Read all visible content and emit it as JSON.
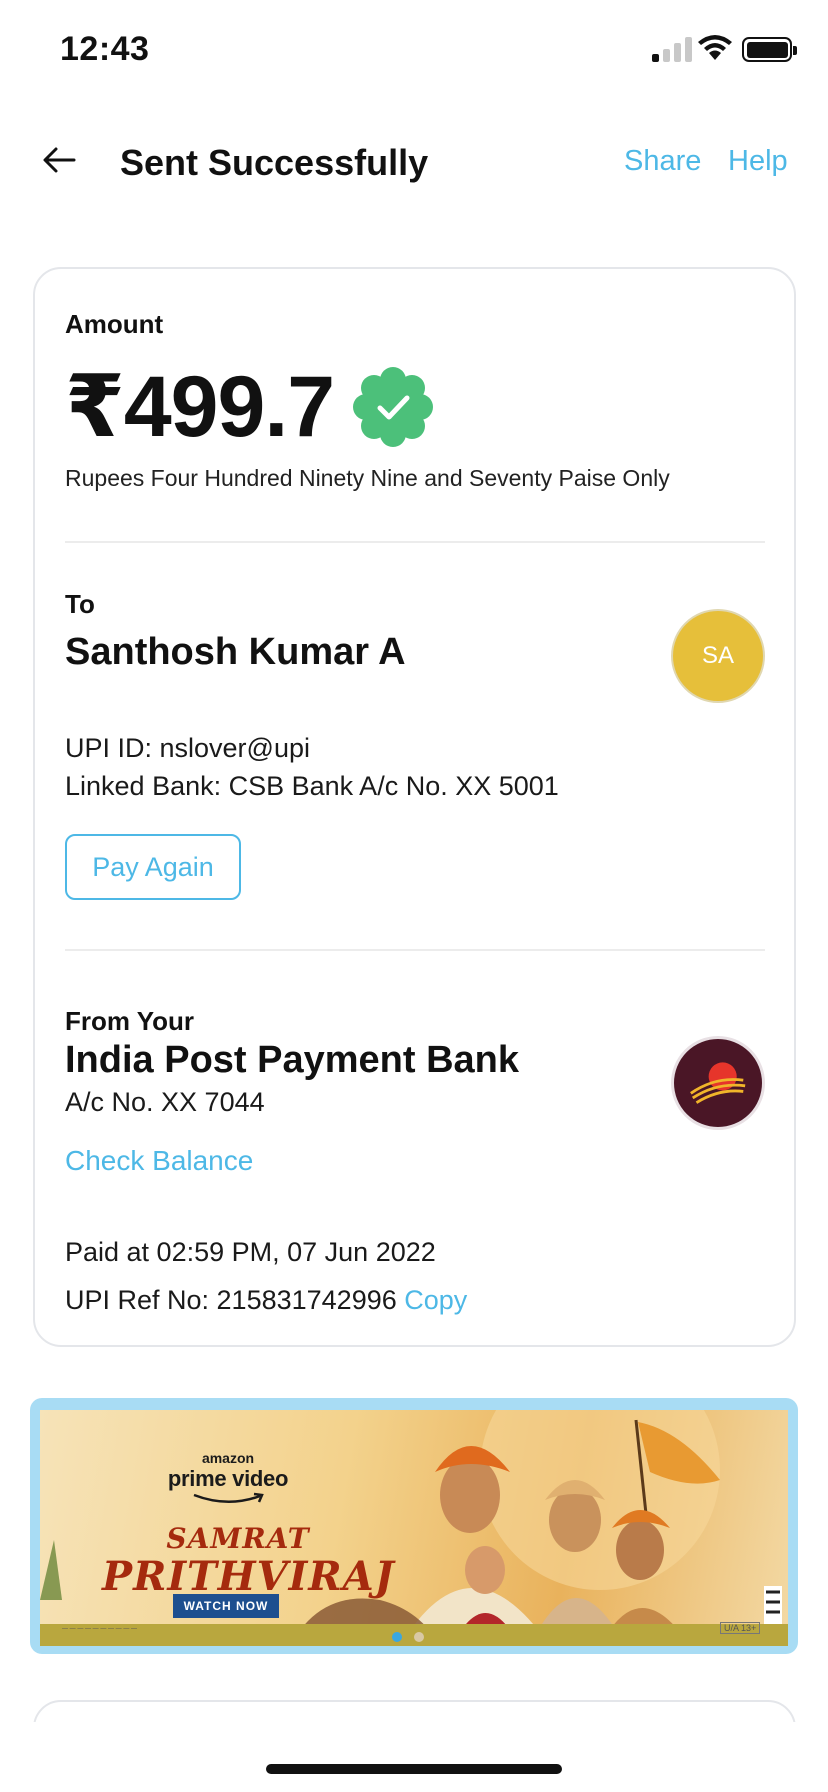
{
  "status_bar": {
    "time": "12:43"
  },
  "header": {
    "title": "Sent Successfully",
    "share_label": "Share",
    "help_label": "Help"
  },
  "amount": {
    "label": "Amount",
    "value": "₹499.7",
    "in_words": "Rupees Four Hundred Ninety Nine and Seventy Paise Only"
  },
  "recipient": {
    "label": "To",
    "name": "Santhosh Kumar A",
    "initials": "SA",
    "upi_id": "UPI ID: nslover@upi",
    "linked_bank": "Linked Bank: CSB Bank A/c No. XX 5001",
    "pay_again_label": "Pay Again"
  },
  "source": {
    "label": "From Your",
    "bank_name": "India Post Payment Bank",
    "account": "A/c No. XX 7044",
    "check_balance_label": "Check Balance"
  },
  "transaction": {
    "paid_at": "Paid at 02:59 PM, 07 Jun 2022",
    "ref_prefix": "UPI Ref No: 215831742996",
    "copy_label": "Copy"
  },
  "banner": {
    "brand_top": "amazon",
    "brand_main": "prime video",
    "title_line1": "SAMRAT",
    "title_line2": "PRITHVIRAJ",
    "cta": "WATCH NOW",
    "rating": "U/A 13+",
    "carousel": {
      "count": 2,
      "active": 0
    }
  },
  "colors": {
    "accent": "#4db8e6",
    "verified_green": "#4cc07a",
    "avatar_bg": "#e6bf3a",
    "bank_logo_bg": "#4a1626"
  },
  "icons": {
    "back": "arrow-left-icon",
    "verified": "verified-badge-icon",
    "bank_logo": "india-post-logo"
  }
}
